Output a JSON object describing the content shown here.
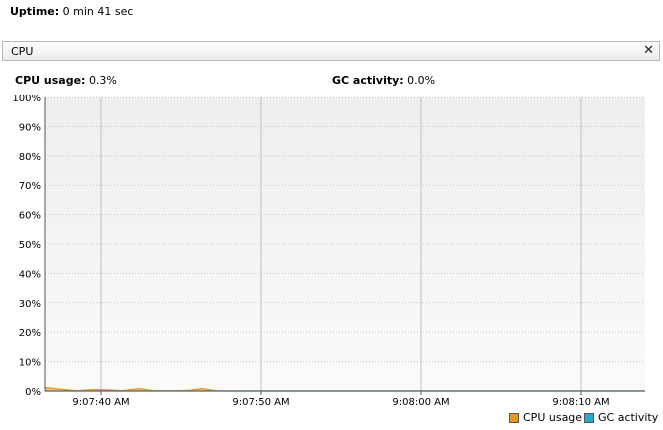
{
  "uptime": {
    "label": "Uptime:",
    "value": "0 min 41 sec"
  },
  "panel": {
    "title": "CPU",
    "close_glyph": "✕"
  },
  "stats": {
    "cpu_label": "CPU usage:",
    "cpu_value": "0.3%",
    "gc_label": "GC activity:",
    "gc_value": "0.0%"
  },
  "colors": {
    "cpu": "#e8961e",
    "gc": "#2aa6d6",
    "plot_bg": "#f4f4f4",
    "grid": "#c8c8c8",
    "axis": "#555555"
  },
  "chart_data": {
    "type": "area",
    "ylim": [
      0,
      100
    ],
    "yticks": [
      "0%",
      "10%",
      "20%",
      "30%",
      "40%",
      "50%",
      "60%",
      "70%",
      "80%",
      "90%",
      "100%"
    ],
    "xticks": [
      {
        "t": 40,
        "label": "9:07:40 AM"
      },
      {
        "t": 50,
        "label": "9:07:50 AM"
      },
      {
        "t": 60,
        "label": "9:08:00 AM"
      },
      {
        "t": 70,
        "label": "9:08:10 AM"
      }
    ],
    "xlim": [
      36.5,
      74
    ],
    "series": [
      {
        "name": "CPU usage",
        "color": "#e8961e",
        "points": [
          [
            36.5,
            1.2
          ],
          [
            37.5,
            0.6
          ],
          [
            38.5,
            0.1
          ],
          [
            39.5,
            0.5
          ],
          [
            40.5,
            0.4
          ],
          [
            41.3,
            0.1
          ],
          [
            42.4,
            0.8
          ],
          [
            43.3,
            0.1
          ],
          [
            44.5,
            0.1
          ],
          [
            45.5,
            0.2
          ],
          [
            46.3,
            0.8
          ],
          [
            47.2,
            0.1
          ],
          [
            48,
            0
          ],
          [
            74,
            0
          ]
        ]
      },
      {
        "name": "GC activity",
        "color": "#2aa6d6",
        "points": [
          [
            36.5,
            0
          ],
          [
            74,
            0
          ]
        ]
      }
    ]
  }
}
